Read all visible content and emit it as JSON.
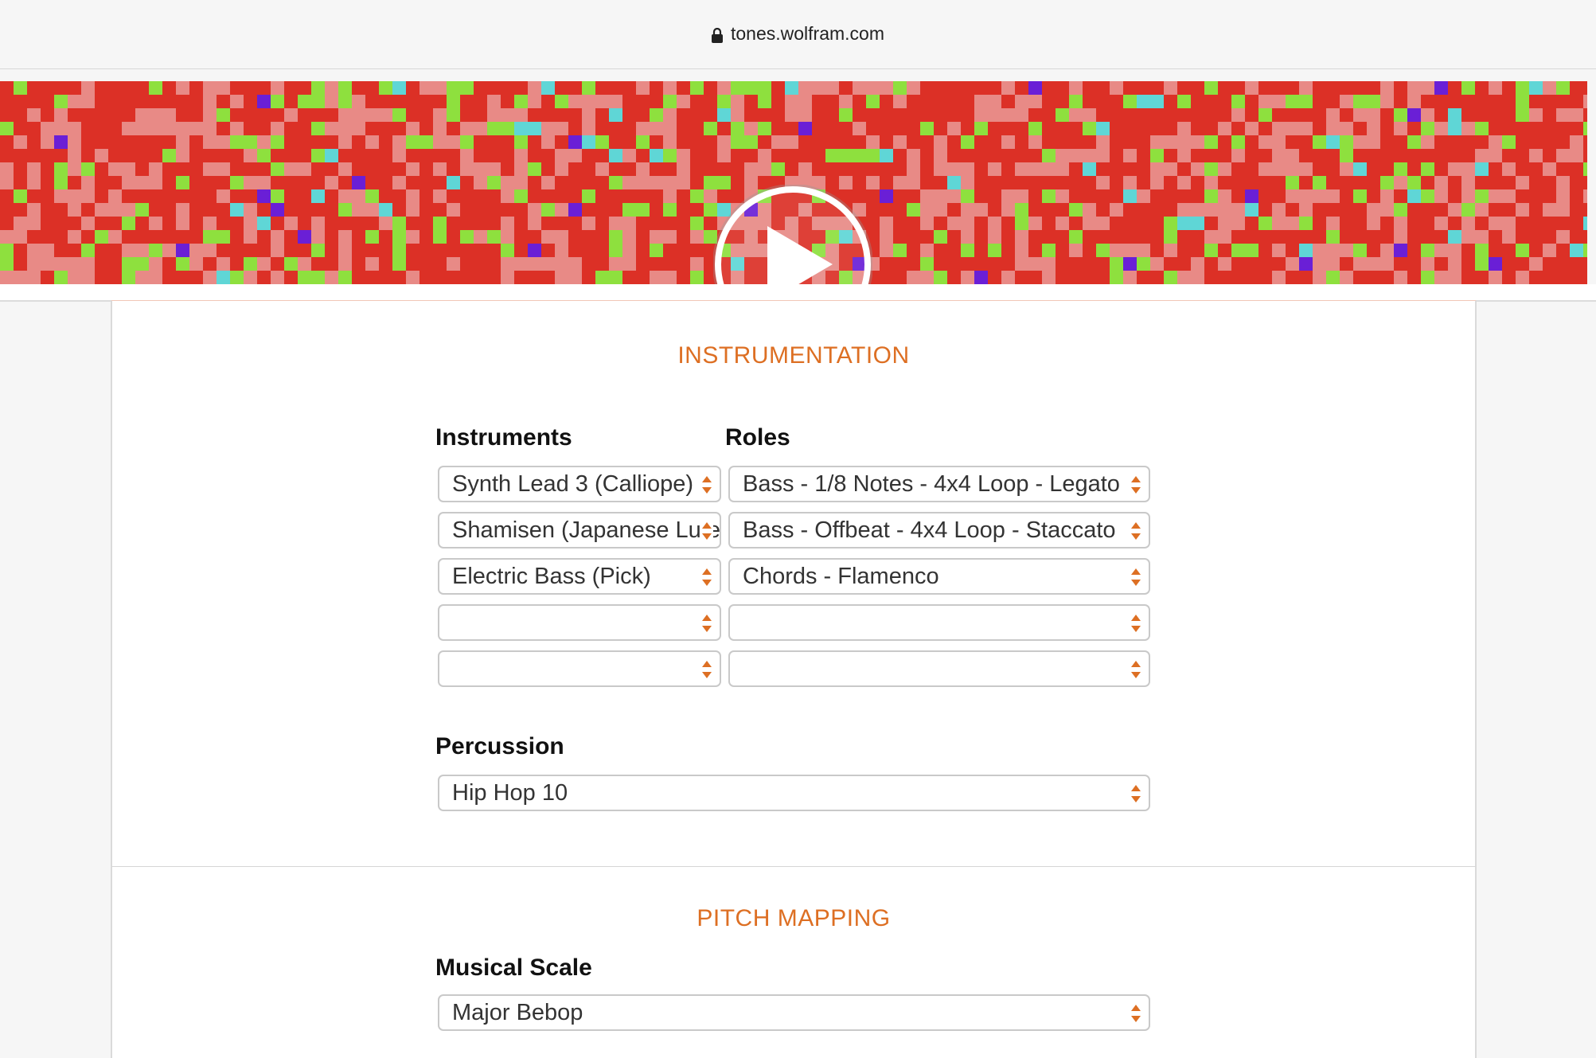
{
  "browser": {
    "url": "tones.wolfram.com"
  },
  "colors": {
    "accent": "#dd6f23",
    "banner_red": "#dc3026",
    "banner_pink": "#e88a86",
    "banner_green": "#8ee03e",
    "banner_purple": "#6a1fd6",
    "banner_cyan": "#5fd6d6"
  },
  "banner": {
    "play_icon": "play-icon"
  },
  "instrumentation": {
    "title": "INSTRUMENTATION",
    "instruments_label": "Instruments",
    "roles_label": "Roles",
    "rows": [
      {
        "instrument": "Synth Lead 3 (Calliope)",
        "role": "Bass - 1/8 Notes - 4x4 Loop - Legato"
      },
      {
        "instrument": "Shamisen (Japanese Lute)",
        "role": "Bass - Offbeat - 4x4 Loop - Staccato"
      },
      {
        "instrument": "Electric Bass (Pick)",
        "role": "Chords - Flamenco"
      },
      {
        "instrument": "",
        "role": ""
      },
      {
        "instrument": "",
        "role": ""
      }
    ],
    "percussion_label": "Percussion",
    "percussion_value": "Hip Hop 10"
  },
  "pitch_mapping": {
    "title": "PITCH MAPPING",
    "scale_label": "Musical Scale",
    "scale_value": "Major Bebop"
  }
}
